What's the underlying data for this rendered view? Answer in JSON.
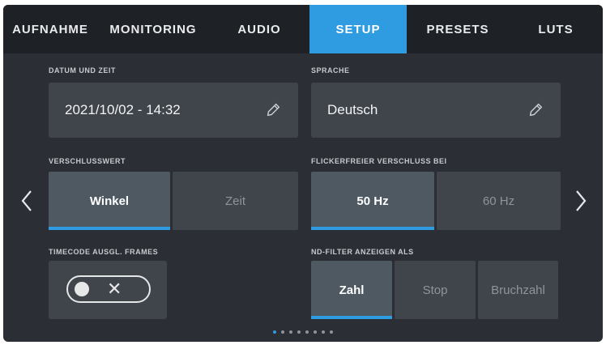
{
  "tabs": [
    {
      "label": "AUFNAHME",
      "active": false
    },
    {
      "label": "MONITORING",
      "active": false
    },
    {
      "label": "AUDIO",
      "active": false
    },
    {
      "label": "SETUP",
      "active": true
    },
    {
      "label": "PRESETS",
      "active": false
    },
    {
      "label": "LUTS",
      "active": false
    }
  ],
  "datetime": {
    "label": "DATUM UND ZEIT",
    "value": "2021/10/02 - 14:32"
  },
  "language": {
    "label": "SPRACHE",
    "value": "Deutsch"
  },
  "shutter": {
    "label": "VERSCHLUSSWERT",
    "options": [
      "Winkel",
      "Zeit"
    ],
    "selected": "Winkel"
  },
  "flicker": {
    "label": "FLICKERFREIER VERSCHLUSS BEI",
    "options": [
      "50 Hz",
      "60 Hz"
    ],
    "selected": "50 Hz"
  },
  "timecode": {
    "label": "TIMECODE AUSGL. FRAMES",
    "toggle_on": false
  },
  "nd_filter": {
    "label": "ND-FILTER ANZEIGEN ALS",
    "options": [
      "Zahl",
      "Stop",
      "Bruchzahl"
    ],
    "selected": "Zahl"
  },
  "pagination": {
    "total": 8,
    "current": 1
  },
  "colors": {
    "accent": "#2f9be0",
    "background": "#2b2f35",
    "tabbar": "#1e2126",
    "field": "#40454c"
  },
  "icons": {
    "edit": "pencil-icon",
    "prev": "chevron-left-icon",
    "next": "chevron-right-icon",
    "toggle_off": "close-icon"
  }
}
